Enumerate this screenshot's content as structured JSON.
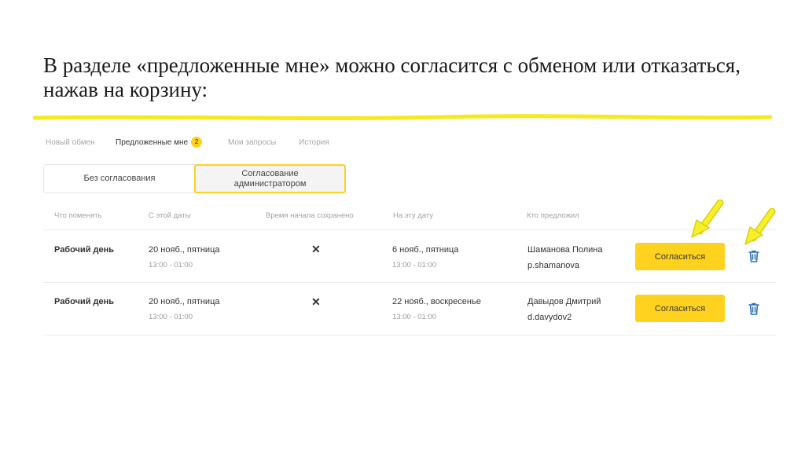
{
  "slide": {
    "title": "В разделе «предложенные мне» можно согласится с обменом или отказаться, нажав на корзину:"
  },
  "tabs": [
    {
      "label": "Новый обмен",
      "active": false
    },
    {
      "label": "Предложенные мне",
      "active": true,
      "badge": "2"
    },
    {
      "label": "Мои запросы",
      "active": false
    },
    {
      "label": "История",
      "active": false
    }
  ],
  "segmented": {
    "left_label": "Без согласования",
    "right_label": "Согласование администратором"
  },
  "table": {
    "headers": [
      "Что поменять",
      "С этой даты",
      "Время начала сохранено",
      "На эту дату",
      "Кто предложил"
    ],
    "rows": [
      {
        "what": "Рабочий день",
        "from_date": "20 нояб., пятница",
        "from_time": "13:00 - 01:00",
        "to_date": "6 нояб., пятница",
        "to_time": "13:00 - 01:00",
        "who_name": "Шаманова Полина",
        "who_login": "p.shamanova",
        "agree_label": "Согласиться"
      },
      {
        "what": "Рабочий день",
        "from_date": "20 нояб., пятница",
        "from_time": "13:00 - 01:00",
        "to_date": "22 нояб., воскресенье",
        "to_time": "13:00 - 01:00",
        "who_name": "Давыдов Дмитрий",
        "who_login": "d.davydov2",
        "agree_label": "Согласиться"
      }
    ]
  },
  "colors": {
    "accent": "#ffd21f",
    "trash": "#2f73b7"
  },
  "icons": {
    "time_saved": "cross-icon",
    "delete": "trash-icon",
    "pointer": "arrow-icon"
  }
}
